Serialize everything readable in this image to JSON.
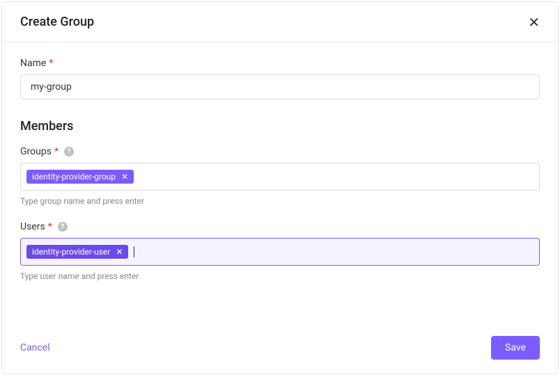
{
  "header": {
    "title": "Create Group"
  },
  "form": {
    "name": {
      "label": "Name",
      "value": "my-group"
    },
    "members_section_title": "Members",
    "groups": {
      "label": "Groups",
      "tags": [
        {
          "text": "identity-provider-group"
        }
      ],
      "helper": "Type group name and press enter"
    },
    "users": {
      "label": "Users",
      "tags": [
        {
          "text": "identity-provider-user"
        }
      ],
      "helper": "Type user name and press enter"
    }
  },
  "footer": {
    "cancel": "Cancel",
    "save": "Save"
  },
  "colors": {
    "accent": "#7c5cff",
    "accent_dark": "#6b4aeb",
    "focus_bg": "#f5f3ff",
    "required": "#e03131"
  }
}
